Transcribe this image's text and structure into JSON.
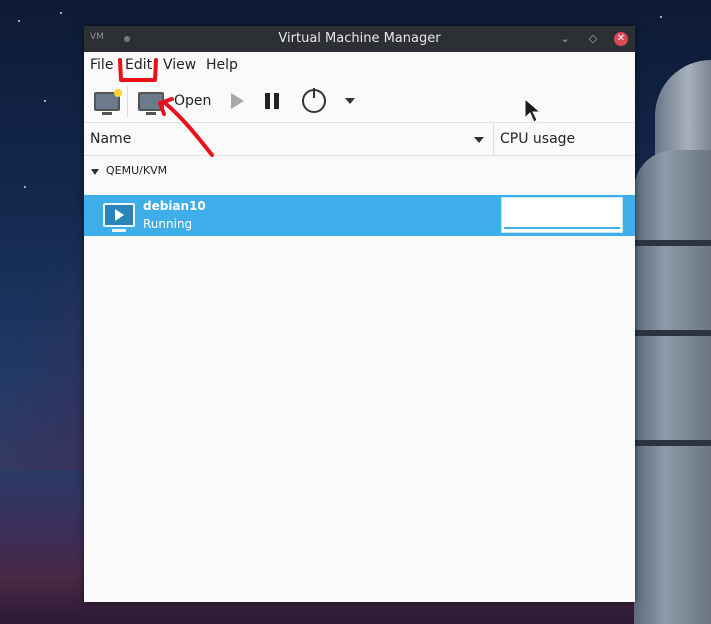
{
  "window": {
    "title": "Virtual Machine Manager",
    "logo_text": "VM"
  },
  "menubar": {
    "items": [
      "File",
      "Edit",
      "View",
      "Help"
    ]
  },
  "toolbar": {
    "open_label": "Open"
  },
  "list": {
    "col_name": "Name",
    "col_cpu": "CPU usage",
    "group": "QEMU/KVM",
    "vm": {
      "name": "debian10",
      "status": "Running"
    }
  },
  "colors": {
    "selection": "#3daee9",
    "titlebar": "#2c2f33",
    "close": "#d94a55",
    "annotation": "#e8121b"
  }
}
